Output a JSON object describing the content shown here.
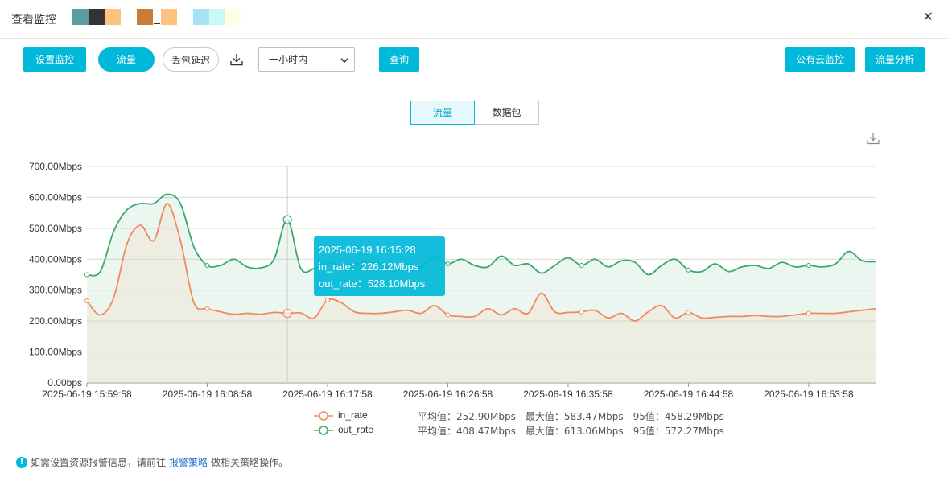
{
  "header": {
    "title": "查看监控",
    "swatches": [
      "#5a9ea2",
      "#333333",
      "#ffc080",
      "",
      "#c87f33",
      "_",
      "#ffc080",
      "",
      "#a8e2f7",
      "#c8f8f8",
      "#fffee0"
    ],
    "close_label": "✕"
  },
  "toolbar": {
    "set_monitor": "设置监控",
    "traffic": "流量",
    "packet_loss": "丢包延迟",
    "download_icon": "download-icon",
    "time_range": "一小时内",
    "query": "查询",
    "public_cloud": "公有云监控",
    "traffic_analysis": "流量分析"
  },
  "segment": {
    "traffic": "流量",
    "packets": "数据包"
  },
  "colors": {
    "accent": "#00b8d9",
    "in_rate": "#f08a5d",
    "out_rate": "#3aa86a",
    "link": "#1f6fd0"
  },
  "chart_data": {
    "type": "area",
    "ylim": [
      0,
      700
    ],
    "yticks": [
      "0.00bps",
      "100.00Mbps",
      "200.00Mbps",
      "300.00Mbps",
      "400.00Mbps",
      "500.00Mbps",
      "600.00Mbps",
      "700.00Mbps"
    ],
    "xticks": [
      "2025-06-19 15:59:58",
      "2025-06-19 16:08:58",
      "2025-06-19 16:17:58",
      "2025-06-19 16:26:58",
      "2025-06-19 16:35:58",
      "2025-06-19 16:44:58",
      "2025-06-19 16:53:58"
    ],
    "x_minutes": [
      0,
      1,
      2,
      3,
      4,
      5,
      6,
      7,
      8,
      9,
      10,
      11,
      12,
      13,
      14,
      15,
      16,
      17,
      18,
      19,
      20,
      21,
      22,
      23,
      24,
      25,
      26,
      27,
      28,
      29,
      30,
      31,
      32,
      33,
      34,
      35,
      36,
      37,
      38,
      39,
      40,
      41,
      42,
      43,
      44,
      45,
      46,
      47,
      48,
      49,
      50,
      51,
      52,
      53,
      54,
      55,
      56,
      57,
      58,
      59
    ],
    "grid": true,
    "series": [
      {
        "name": "in_rate",
        "values": [
          265,
          220,
          275,
          450,
          510,
          460,
          580,
          460,
          260,
          240,
          230,
          222,
          225,
          222,
          228,
          225,
          226,
          210,
          268,
          260,
          230,
          225,
          225,
          230,
          235,
          225,
          250,
          220,
          215,
          215,
          240,
          220,
          240,
          225,
          290,
          230,
          228,
          230,
          235,
          210,
          225,
          200,
          230,
          250,
          210,
          228,
          210,
          212,
          215,
          215,
          218,
          215,
          215,
          220,
          225,
          225,
          225,
          230,
          235,
          240
        ]
      },
      {
        "name": "out_rate",
        "values": [
          350,
          360,
          490,
          560,
          580,
          580,
          610,
          580,
          440,
          380,
          380,
          400,
          375,
          372,
          400,
          528,
          370,
          370,
          390,
          380,
          385,
          390,
          385,
          360,
          385,
          375,
          410,
          385,
          400,
          380,
          375,
          410,
          380,
          385,
          355,
          380,
          405,
          380,
          400,
          375,
          395,
          390,
          350,
          380,
          400,
          365,
          360,
          385,
          360,
          375,
          380,
          370,
          390,
          375,
          380,
          375,
          385,
          425,
          395,
          392
        ]
      }
    ],
    "markers": [
      0,
      9,
      15,
      18,
      27,
      37,
      45,
      54
    ],
    "tooltip": {
      "index": 15,
      "time": "2025-06-19 16:15:28",
      "in_label": "in_rate：226.12Mbps",
      "out_label": "out_rate：528.10Mbps"
    }
  },
  "legend": {
    "in": {
      "name": "in_rate",
      "stats": "平均值：252.90Mbps　最大值：583.47Mbps　95值：458.29Mbps"
    },
    "out": {
      "name": "out_rate",
      "stats": "平均值：408.47Mbps　最大值：613.06Mbps　95值：572.27Mbps"
    }
  },
  "footer": {
    "prefix": "如需设置资源报警信息，请前往",
    "link": "报警策略",
    "suffix": "做相关策略操作。"
  }
}
